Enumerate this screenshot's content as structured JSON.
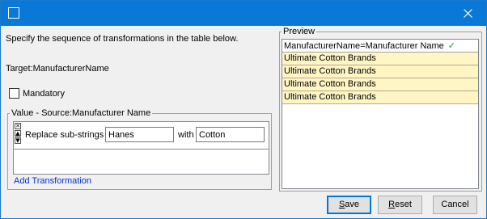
{
  "window": {
    "title": ""
  },
  "instructions": "Specify the sequence of transformations in the table below.",
  "target_label": "Target:ManufacturerName",
  "mandatory": {
    "label": "Mandatory",
    "checked": false
  },
  "value_group": {
    "legend": "Value - Source:Manufacturer Name",
    "transformation": {
      "label": "Replace sub-strings",
      "find_value": "Hanes",
      "with_label": "with",
      "replace_value": "Cotton"
    },
    "add_link": "Add Transformation"
  },
  "preview": {
    "legend": "Preview",
    "header": "ManufacturerName=Manufacturer Name",
    "check_icon": "checkmark-icon",
    "rows": [
      "Ultimate Cotton Brands",
      "Ultimate Cotton Brands",
      "Ultimate Cotton Brands",
      "Ultimate Cotton Brands"
    ],
    "row_color": "#fff6c4"
  },
  "buttons": {
    "save_first": "S",
    "save_rest": "ave",
    "reset_first": "R",
    "reset_rest": "eset",
    "cancel": "Cancel"
  },
  "colors": {
    "titlebar": "#0a78d7",
    "link": "#0033cc",
    "check": "#1a9c3a"
  }
}
